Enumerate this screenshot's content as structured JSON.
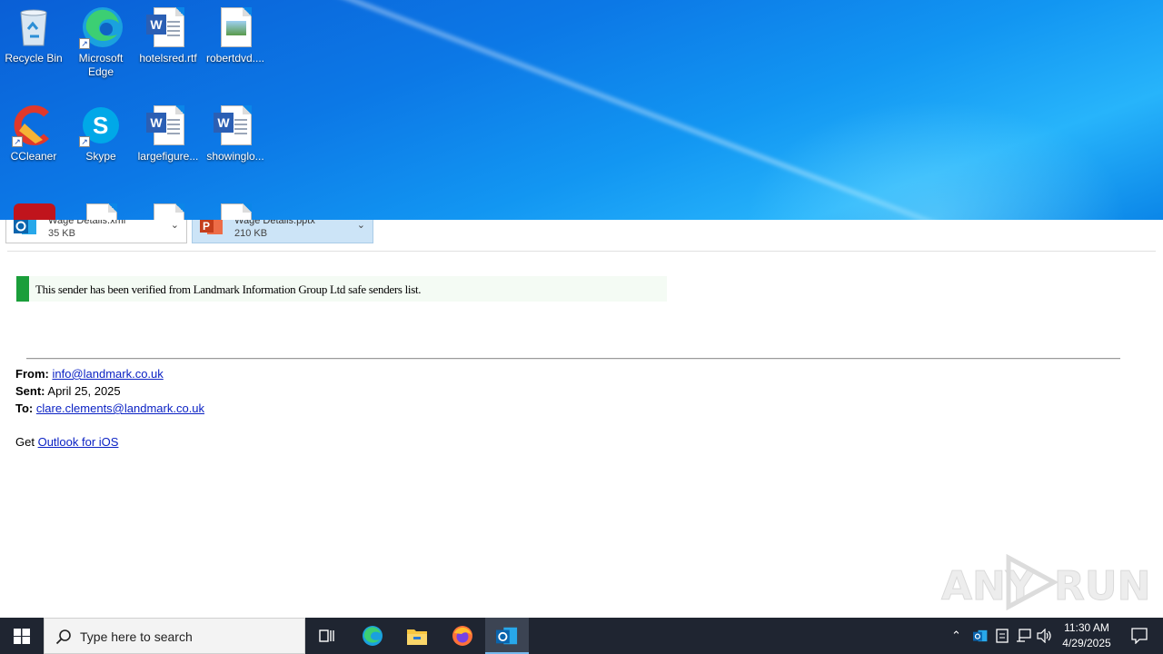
{
  "attachments": [
    {
      "name": "Wage Details.xml",
      "size": "35 KB",
      "type": "outlook"
    },
    {
      "name": "Wage Details.pptx",
      "size": "210 KB",
      "type": "powerpoint"
    }
  ],
  "banner": {
    "text": "This sender has been verified from Landmark Information Group Ltd safe senders list."
  },
  "header": {
    "from_label": "From:",
    "from_value": "info@landmark.co.uk",
    "sent_label": "Sent:",
    "sent_value": "April 25, 2025",
    "to_label": "To:",
    "to_value": "clare.clements@landmark.co.uk"
  },
  "body": {
    "get_text": "Get",
    "link_text": "Outlook for iOS"
  },
  "watermark": {
    "left": "ANY",
    "right": "RUN"
  },
  "desktop": {
    "icons": [
      {
        "label": "Recycle Bin"
      },
      {
        "label": "Microsoft Edge"
      },
      {
        "label": "hotelsred.rtf"
      },
      {
        "label": "robertdvd...."
      },
      {
        "label": "CCleaner"
      },
      {
        "label": "Skype"
      },
      {
        "label": "largefigure..."
      },
      {
        "label": "showinglo..."
      }
    ]
  },
  "taskbar": {
    "search_placeholder": "Type here to search",
    "time": "11:30 AM",
    "date": "4/29/2025"
  },
  "colors": {
    "accent": "#0078d7",
    "banner_green": "#1a9e3a",
    "link": "#0b22c4",
    "taskbar": "#1f2531"
  }
}
